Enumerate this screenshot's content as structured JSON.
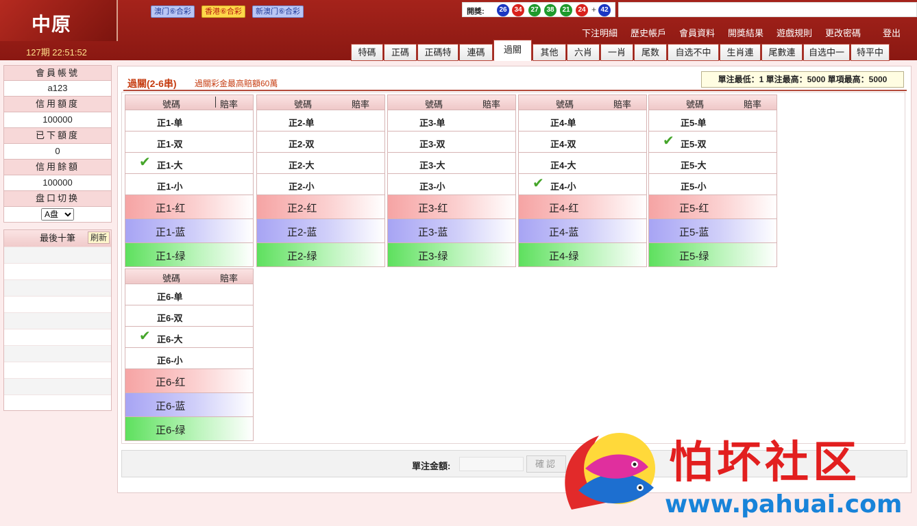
{
  "header": {
    "logo": "中原",
    "period": "127期 22:51:52",
    "lottery_tabs": [
      "澳门⑥合彩",
      "香港⑥合彩",
      "新澳门⑥合彩"
    ],
    "active_lottery": 1,
    "draw_label": "開獎:",
    "draw_balls": [
      {
        "num": "26",
        "color": "#1a36c2"
      },
      {
        "num": "34",
        "color": "#d9221c"
      },
      {
        "num": "27",
        "color": "#1e9a2b"
      },
      {
        "num": "38",
        "color": "#1e9a2b"
      },
      {
        "num": "21",
        "color": "#1e9a2b"
      },
      {
        "num": "24",
        "color": "#d9221c"
      },
      {
        "num": "42",
        "color": "#1a36c2"
      }
    ],
    "draw_plus": "+",
    "top_links": [
      "下注明細",
      "歷史帳戶",
      "會員資料",
      "開獎結果",
      "遊戲規則",
      "更改密碼",
      "登出"
    ],
    "play_tabs": [
      "特碼",
      "正碼",
      "正碼特",
      "連碼",
      "過關",
      "其他",
      "六肖",
      "一肖",
      "尾数",
      "自选不中",
      "生肖連",
      "尾數連",
      "自选中一",
      "特平中"
    ],
    "active_play_tab": 4
  },
  "sidebar": {
    "rows": [
      {
        "head": "會員帳號",
        "value": "a123"
      },
      {
        "head": "信用額度",
        "value": "100000"
      },
      {
        "head": "已下額度",
        "value": "0"
      },
      {
        "head": "信用餘額",
        "value": "100000"
      }
    ],
    "pan_label": "盘口切换",
    "pan_value": "A盘",
    "last10_label": "最後十筆",
    "refresh_label": "刷新"
  },
  "main": {
    "title": "過關(2-6串)",
    "note": "過關彩金最高賠額60萬",
    "limits": "單注最低：1  單注最高：5000  單項最高：5000",
    "col_head_number": "號碼",
    "col_head_odds": "賠率",
    "groups": [
      {
        "items": [
          "正1-单",
          "正1-双",
          "正1-大",
          "正1-小"
        ],
        "checked": 2,
        "colors": [
          "正1-红",
          "正1-蓝",
          "正1-绿"
        ]
      },
      {
        "items": [
          "正2-单",
          "正2-双",
          "正2-大",
          "正2-小"
        ],
        "checked": -1,
        "colors": [
          "正2-红",
          "正2-蓝",
          "正2-绿"
        ]
      },
      {
        "items": [
          "正3-单",
          "正3-双",
          "正3-大",
          "正3-小"
        ],
        "checked": -1,
        "colors": [
          "正3-红",
          "正3-蓝",
          "正3-绿"
        ]
      },
      {
        "items": [
          "正4-单",
          "正4-双",
          "正4-大",
          "正4-小"
        ],
        "checked": 3,
        "colors": [
          "正4-红",
          "正4-蓝",
          "正4-绿"
        ]
      },
      {
        "items": [
          "正5-单",
          "正5-双",
          "正5-大",
          "正5-小"
        ],
        "checked": 1,
        "colors": [
          "正5-红",
          "正5-蓝",
          "正5-绿"
        ]
      },
      {
        "items": [
          "正6-单",
          "正6-双",
          "正6-大",
          "正6-小"
        ],
        "checked": 2,
        "colors": [
          "正6-红",
          "正6-蓝",
          "正6-绿"
        ]
      }
    ],
    "check_mark": "✔",
    "bet_label": "單注金額:",
    "bet_value": "",
    "confirm_label": "確認"
  },
  "watermark": {
    "title": "怕坏社区",
    "url": "www.pahuai.com"
  }
}
